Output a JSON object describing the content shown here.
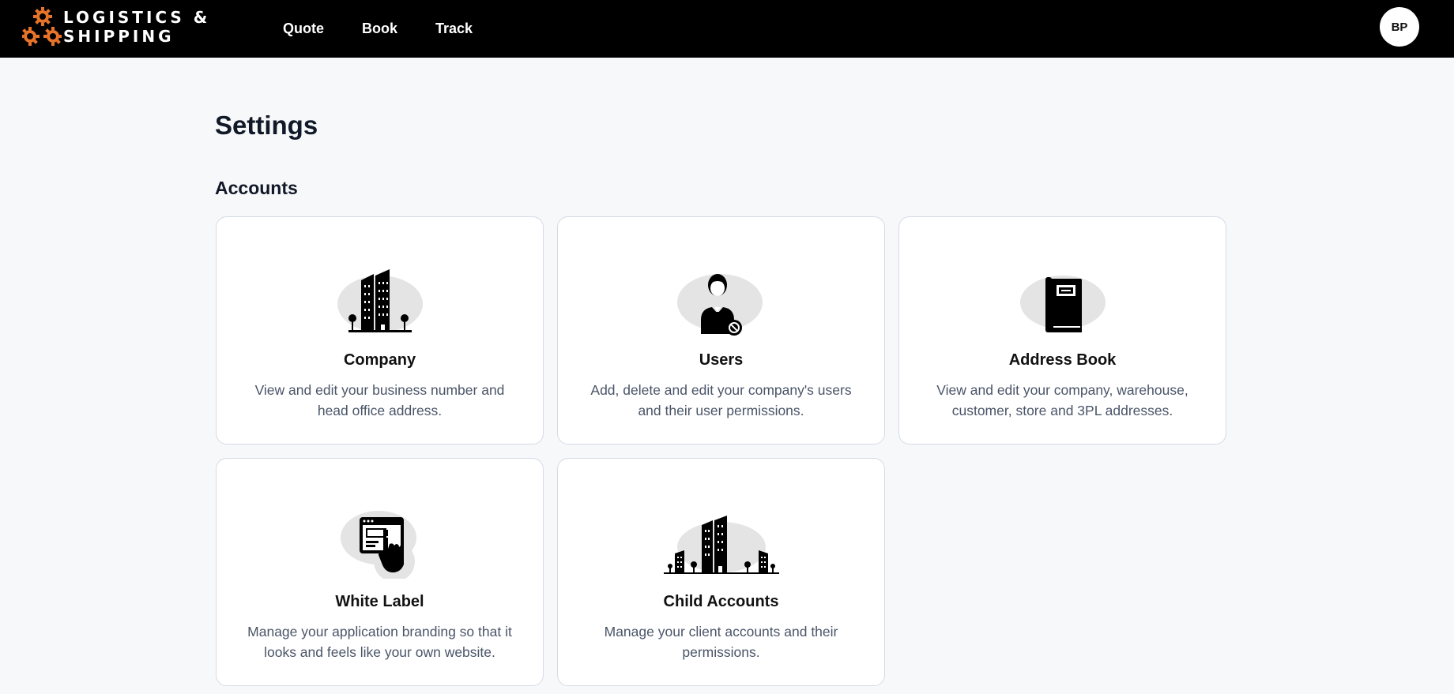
{
  "header": {
    "logo_line1": "LOGISTICS &",
    "logo_line2": "SHIPPING",
    "nav": [
      "Quote",
      "Book",
      "Track"
    ],
    "avatar_initials": "BP"
  },
  "page": {
    "title": "Settings",
    "section": "Accounts"
  },
  "cards": [
    {
      "title": "Company",
      "desc": "View and edit your business number and head office address.",
      "icon": "office-building-icon"
    },
    {
      "title": "Users",
      "desc": "Add, delete and edit your company's users and their user permissions.",
      "icon": "user-permissions-icon"
    },
    {
      "title": "Address Book",
      "desc": "View and edit your company, warehouse, customer, store and 3PL addresses.",
      "icon": "address-book-icon"
    },
    {
      "title": "White Label",
      "desc": "Manage your application branding so that it looks and feels like your own website.",
      "icon": "white-label-browser-icon"
    },
    {
      "title": "Child Accounts",
      "desc": "Manage your client accounts and their permissions.",
      "icon": "child-accounts-buildings-icon"
    }
  ],
  "colors": {
    "brand_accent": "#e8742a",
    "header_bg": "#000000",
    "icon_blob": "#e4e4e4"
  }
}
